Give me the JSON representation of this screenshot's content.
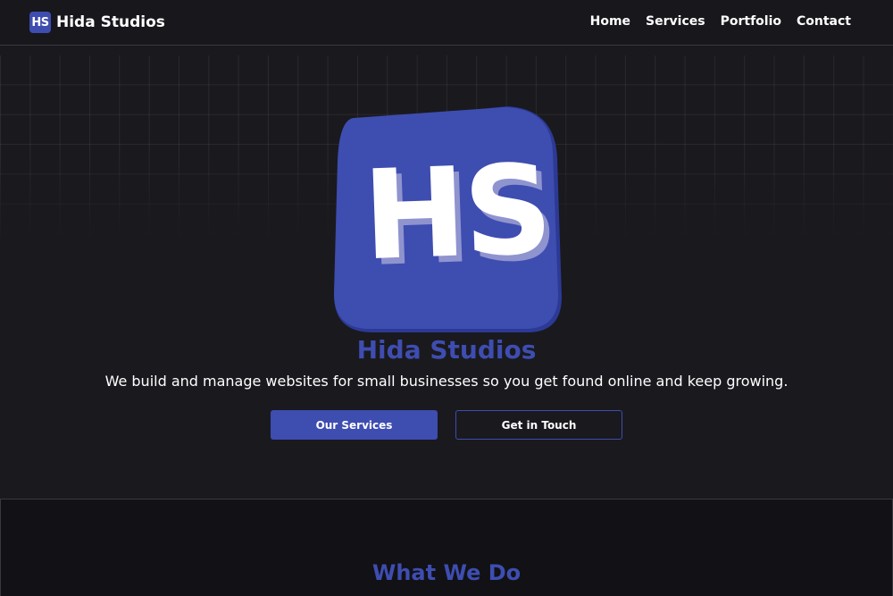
{
  "header": {
    "brand_logo_text": "HS",
    "brand_name": "Hida Studios",
    "nav": [
      "Home",
      "Services",
      "Portfolio",
      "Contact"
    ]
  },
  "hero": {
    "logo_text": "HS",
    "title": "Hida Studios",
    "subtitle": "We build and manage websites for small businesses so you get found online and keep growing.",
    "primary_button": "Our Services",
    "secondary_button": "Get in Touch"
  },
  "section": {
    "title": "What We Do"
  },
  "colors": {
    "accent": "#3e4db0",
    "background": "#18171c",
    "section_background": "#121115"
  }
}
